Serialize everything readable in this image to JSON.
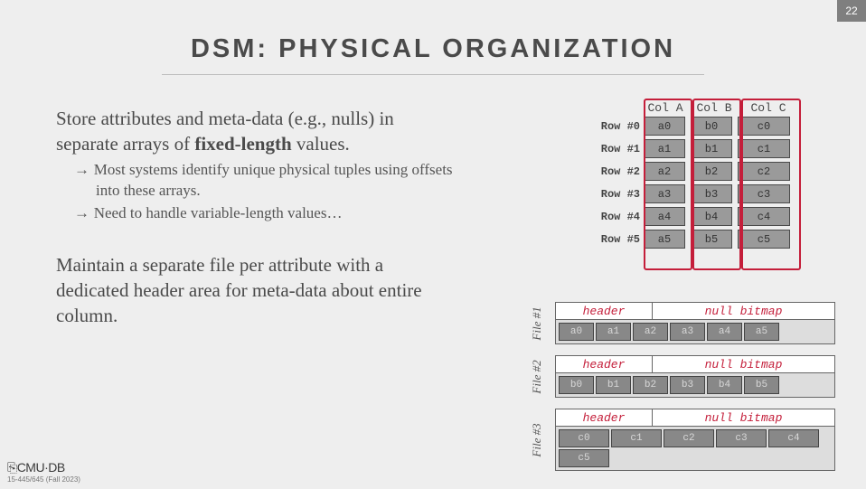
{
  "page_number": "22",
  "title": "DSM: PHYSICAL ORGANIZATION",
  "para1_pre": "Store attributes and meta-data (e.g., nulls) in separate arrays of ",
  "para1_bold": "fixed-length",
  "para1_post": " values.",
  "bullets": [
    "Most systems identify unique physical tuples using offsets into these arrays.",
    "Need to handle variable-length values…"
  ],
  "para2": "Maintain a separate file per attribute with a dedicated header area for meta-data about entire column.",
  "logical": {
    "col_headers": [
      "Col A",
      "Col B",
      "Col C"
    ],
    "row_labels": [
      "Row #0",
      "Row #1",
      "Row #2",
      "Row #3",
      "Row #4",
      "Row #5"
    ],
    "colA": [
      "a0",
      "a1",
      "a2",
      "a3",
      "a4",
      "a5"
    ],
    "colB": [
      "b0",
      "b1",
      "b2",
      "b3",
      "b4",
      "b5"
    ],
    "colC": [
      "c0",
      "c1",
      "c2",
      "c3",
      "c4",
      "c5"
    ]
  },
  "file_hdr_header": "header",
  "file_hdr_null": "null bitmap",
  "files": [
    {
      "label": "File #1",
      "cells": [
        "a0",
        "a1",
        "a2",
        "a3",
        "a4",
        "a5"
      ]
    },
    {
      "label": "File #2",
      "cells": [
        "b0",
        "b1",
        "b2",
        "b3",
        "b4",
        "b5"
      ]
    },
    {
      "label": "File #3",
      "cells": [
        "c0",
        "c1",
        "c2",
        "c3",
        "c4",
        "c5"
      ]
    }
  ],
  "footer_logo": "⎘CMU·DB",
  "footer_course": "15-445/645 (Fall 2023)"
}
